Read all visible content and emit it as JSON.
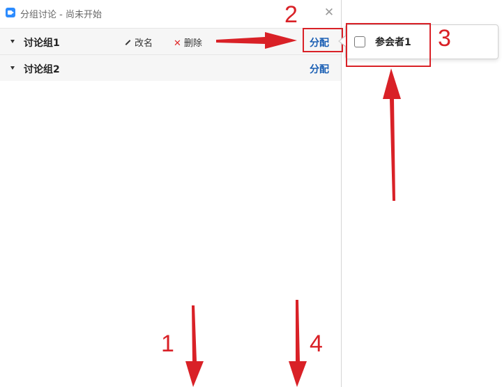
{
  "window": {
    "title": "分组讨论 - 尚未开始",
    "close_label": "✕"
  },
  "groups": [
    {
      "name": "讨论组1",
      "rename_label": "改名",
      "delete_label": "删除",
      "assign_label": "分配"
    },
    {
      "name": "讨论组2",
      "assign_label": "分配"
    }
  ],
  "popover": {
    "participant_name": "参会者1"
  },
  "annotations": [
    "1",
    "2",
    "3",
    "4"
  ],
  "colors": {
    "annotation": "#d92127",
    "assign_link": "#1a5fb4",
    "app_icon": "#2d8cff"
  },
  "icons": [
    "app-logo-icon",
    "close-icon",
    "caret-down-icon",
    "pencil-icon",
    "delete-x-icon"
  ]
}
